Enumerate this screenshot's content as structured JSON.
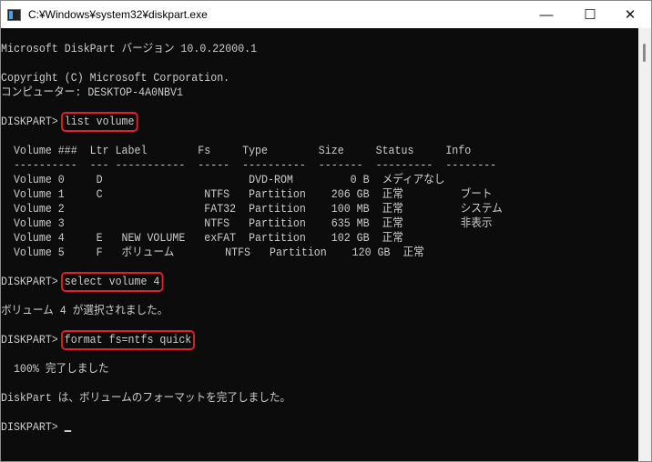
{
  "window": {
    "title": "C:¥Windows¥system32¥diskpart.exe",
    "minimize": "—",
    "maximize": "☐",
    "close": "✕"
  },
  "console": {
    "version_line": "Microsoft DiskPart バージョン 10.0.22000.1",
    "copyright": "Copyright (C) Microsoft Corporation.",
    "computer": "コンピューター: DESKTOP-4A0NBV1",
    "prompt": "DISKPART> ",
    "cmd1": "list volume",
    "table_header": "  Volume ###  Ltr Label        Fs     Type        Size     Status     Info",
    "table_sep": "  ----------  --- -----------  -----  ----------  -------  ---------  --------",
    "rows": [
      "  Volume 0     D                       DVD-ROM         0 B  メディアなし",
      "  Volume 1     C                NTFS   Partition    206 GB  正常         ブート",
      "  Volume 2                      FAT32  Partition    100 MB  正常         システム",
      "  Volume 3                      NTFS   Partition    635 MB  正常         非表示",
      "  Volume 4     E   NEW VOLUME   exFAT  Partition    102 GB  正常",
      "  Volume 5     F   ボリューム        NTFS   Partition    120 GB  正常"
    ],
    "cmd2": "select volume 4",
    "msg2": "ボリューム 4 が選択されました。",
    "cmd3": "format fs=ntfs quick",
    "progress": "  100% 完了しました",
    "msg3": "DiskPart は、ボリュームのフォーマットを完了しました。"
  }
}
